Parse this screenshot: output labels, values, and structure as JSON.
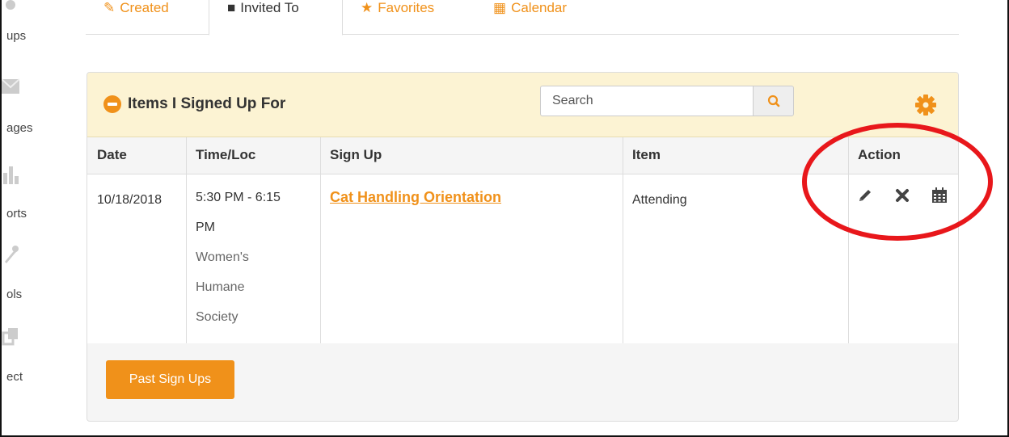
{
  "sidebar": {
    "items": [
      {
        "label": "ups",
        "icon": "groups-icon"
      },
      {
        "label": "ages",
        "icon": "messages-icon"
      },
      {
        "label": "orts",
        "icon": "reports-icon"
      },
      {
        "label": "ols",
        "icon": "tools-icon"
      },
      {
        "label": "ect",
        "icon": "select-icon"
      }
    ]
  },
  "tabs": [
    {
      "label": "Created",
      "icon": "pencil-icon"
    },
    {
      "label": "Invited To",
      "icon": "envelope-icon"
    },
    {
      "label": "Favorites",
      "icon": "star-icon"
    },
    {
      "label": "Calendar",
      "icon": "calendar-icon"
    }
  ],
  "panel": {
    "title": "Items I Signed Up For",
    "search_placeholder": "Search",
    "columns": [
      "Date",
      "Time/Loc",
      "Sign Up",
      "Item",
      "Action"
    ],
    "rows": [
      {
        "date": "10/18/2018",
        "time_line1": "5:30 PM - 6:15",
        "time_line2": "PM",
        "location": "Women's Humane Society",
        "signup": "Cat Handling Orientation",
        "item": "Attending",
        "actions": [
          "edit-icon",
          "delete-icon",
          "calendar-icon"
        ]
      }
    ],
    "past_button": "Past Sign Ups"
  },
  "colors": {
    "accent": "#f0911a",
    "header_bg": "#fcf3d3",
    "annotation": "#e8171b"
  }
}
